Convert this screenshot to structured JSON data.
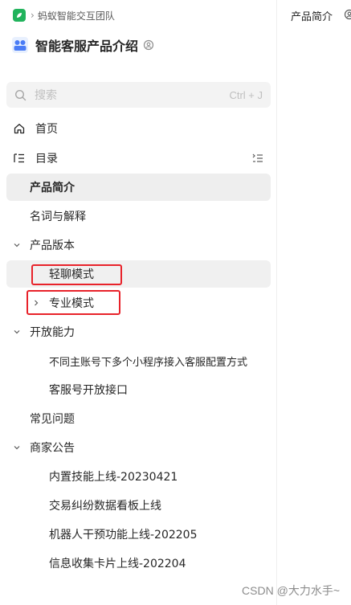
{
  "breadcrumb": {
    "team": "蚂蚁智能交互团队"
  },
  "book": {
    "title": "智能客服产品介绍"
  },
  "search": {
    "placeholder": "搜索",
    "shortcut": "Ctrl + J"
  },
  "nav": {
    "home": "首页",
    "toc": "目录"
  },
  "tree": [
    {
      "label": "产品简介"
    },
    {
      "label": "名词与解释"
    },
    {
      "label": "产品版本"
    },
    {
      "label": "轻聊模式"
    },
    {
      "label": "专业模式"
    },
    {
      "label": "开放能力"
    },
    {
      "label": "不同主账号下多个小程序接入客服配置方式"
    },
    {
      "label": "客服号开放接口"
    },
    {
      "label": "常见问题"
    },
    {
      "label": "商家公告"
    },
    {
      "label": "内置技能上线-20230421"
    },
    {
      "label": "交易纠纷数据看板上线"
    },
    {
      "label": "机器人干预功能上线-202205"
    },
    {
      "label": "信息收集卡片上线-202204"
    }
  ],
  "right": {
    "title": "产品简介"
  },
  "watermark": "CSDN @大力水手~",
  "colors": {
    "brand": "#21b35c",
    "highlight_box": "#e8222a",
    "selected_bg": "#eeeeee"
  }
}
